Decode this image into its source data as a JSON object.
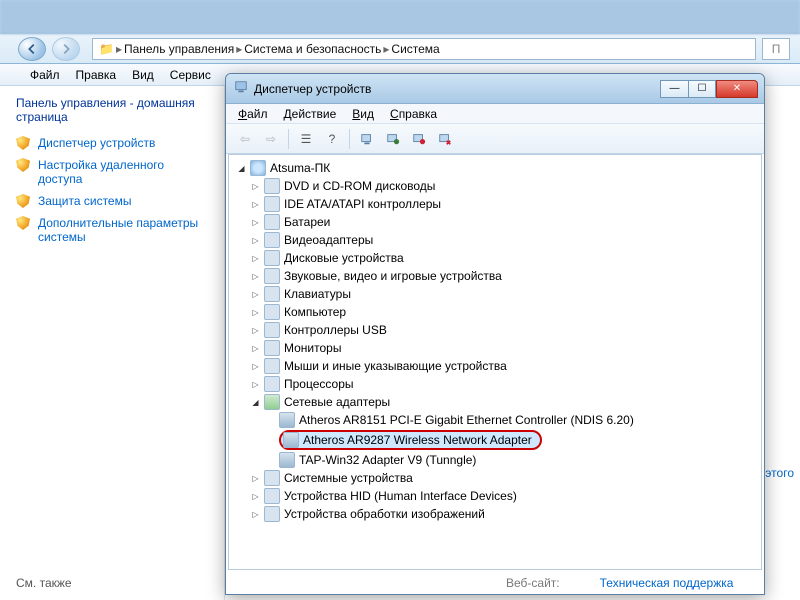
{
  "breadcrumbs": {
    "items": [
      "Панель управления",
      "Система и безопасность",
      "Система"
    ]
  },
  "search_placeholder": "П",
  "outer_menu": [
    "Файл",
    "Правка",
    "Вид",
    "Сервис"
  ],
  "cp_sidebar": {
    "heading": "Панель управления - домашняя страница",
    "items": [
      "Диспетчер устройств",
      "Настройка удаленного доступа",
      "Защита системы",
      "Дополнительные параметры системы"
    ],
    "see_also_label": "См. также"
  },
  "right_info": "для этого",
  "devmgr": {
    "title": "Диспетчер устройств",
    "menu": [
      "Файл",
      "Действие",
      "Вид",
      "Справка"
    ],
    "root": "Atsuma-ПК",
    "categories": [
      "DVD и CD-ROM дисководы",
      "IDE ATA/ATAPI контроллеры",
      "Батареи",
      "Видеоадаптеры",
      "Дисковые устройства",
      "Звуковые, видео и игровые устройства",
      "Клавиатуры",
      "Компьютер",
      "Контроллеры USB",
      "Мониторы",
      "Мыши и иные указывающие устройства",
      "Процессоры"
    ],
    "network_label": "Сетевые адаптеры",
    "network_children": [
      "Atheros AR8151 PCI-E Gigabit Ethernet Controller (NDIS 6.20)",
      "Atheros AR9287 Wireless Network Adapter",
      "TAP-Win32 Adapter V9 (Tunngle)"
    ],
    "after_network": [
      "Системные устройства",
      "Устройства HID (Human Interface Devices)",
      "Устройства обработки изображений"
    ],
    "status_label": "Веб-сайт:",
    "status_link": "Техническая поддержка"
  }
}
